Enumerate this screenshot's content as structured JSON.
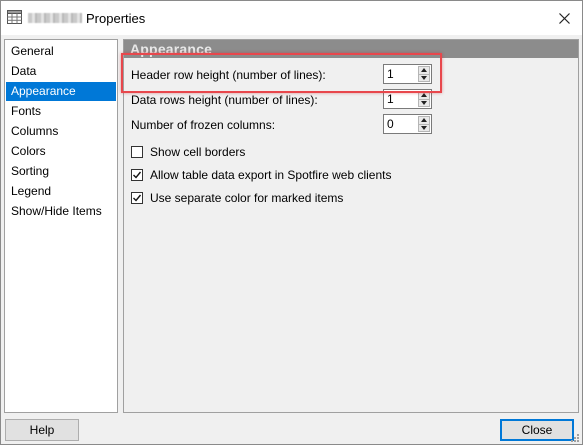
{
  "window": {
    "title": "Properties",
    "close_glyph": "✕"
  },
  "sidebar": {
    "items": [
      {
        "label": "General",
        "selected": false
      },
      {
        "label": "Data",
        "selected": false
      },
      {
        "label": "Appearance",
        "selected": true
      },
      {
        "label": "Fonts",
        "selected": false
      },
      {
        "label": "Columns",
        "selected": false
      },
      {
        "label": "Colors",
        "selected": false
      },
      {
        "label": "Sorting",
        "selected": false
      },
      {
        "label": "Legend",
        "selected": false
      },
      {
        "label": "Show/Hide Items",
        "selected": false
      }
    ]
  },
  "panel": {
    "header": "Appearance",
    "header_row_height": {
      "label": "Header row height (number of lines):",
      "value": "1"
    },
    "data_rows_height": {
      "label": "Data rows height (number of lines):",
      "value": "1"
    },
    "frozen_columns": {
      "label": "Number of frozen columns:",
      "value": "0"
    },
    "checkboxes": [
      {
        "label": "Show cell borders",
        "checked": false
      },
      {
        "label": "Allow table data export in Spotfire web clients",
        "checked": true
      },
      {
        "label": "Use separate color for marked items",
        "checked": true
      }
    ]
  },
  "buttons": {
    "help": "Help",
    "close": "Close"
  },
  "colors": {
    "selection": "#0078d7",
    "highlight_box": "#e8474c",
    "section_header": "#8c8c8c"
  }
}
